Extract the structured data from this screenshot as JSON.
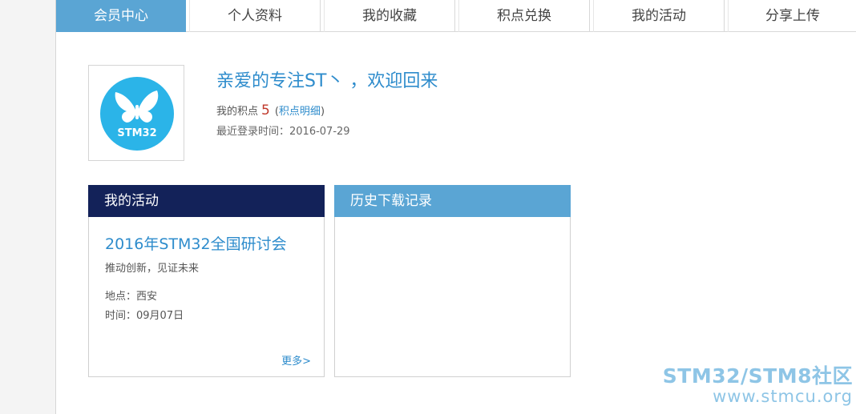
{
  "tabs": [
    {
      "label": "会员中心",
      "active": true
    },
    {
      "label": "个人资料",
      "active": false
    },
    {
      "label": "我的收藏",
      "active": false
    },
    {
      "label": "积点兑换",
      "active": false
    },
    {
      "label": "我的活动",
      "active": false
    },
    {
      "label": "分享上传",
      "active": false
    }
  ],
  "profile": {
    "avatar_text": "STM32",
    "greeting": "亲爱的专注ST丶 ，欢迎回来",
    "points_label": "我的积点",
    "points_value": "5",
    "points_detail_open": "(",
    "points_detail_link": "积点明细",
    "points_detail_close": ")",
    "last_login": "最近登录时间：2016-07-29"
  },
  "activity_panel": {
    "title": "我的活动",
    "event_title": "2016年STM32全国研讨会",
    "event_subtitle": "推动创新，见证未来",
    "event_place": "地点：西安",
    "event_time": "时间：09月07日",
    "more_link": "更多>"
  },
  "history_panel": {
    "title": "历史下载记录"
  },
  "watermark": {
    "line1": "STM32/STM8社区",
    "line2": "www.stmcu.org"
  },
  "colors": {
    "accent": "#5aa5d4",
    "link": "#2e8ccc",
    "dark_header": "#132259",
    "avatar_circle": "#2bb4e8",
    "points_red": "#c0392b"
  }
}
